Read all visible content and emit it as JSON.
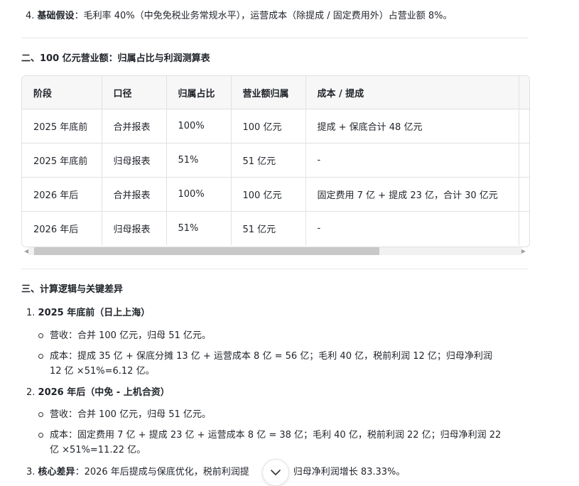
{
  "assumption": {
    "number": "4.",
    "label": "基础假设",
    "sep": "：",
    "text": "毛利率 40%（中免免税业务常规水平），运营成本（除提成 / 固定费用外）占营业额 8%。"
  },
  "section2": {
    "title": "二、100 亿元营业额：归属占比与利润测算表"
  },
  "table": {
    "headers": [
      "阶段",
      "口径",
      "归属占比",
      "营业额归属",
      "成本 / 提成"
    ],
    "rows": [
      [
        "2025 年底前",
        "合并报表",
        "100%",
        "100 亿元",
        "提成 + 保底合计 48 亿元"
      ],
      [
        "2025 年底前",
        "归母报表",
        "51%",
        "51 亿元",
        "-"
      ],
      [
        "2026 年后",
        "合并报表",
        "100%",
        "100 亿元",
        "固定费用 7 亿 + 提成 23 亿，合计 30 亿元"
      ],
      [
        "2026 年后",
        "归母报表",
        "51%",
        "51 亿元",
        "-"
      ]
    ]
  },
  "section3": {
    "title": "三、计算逻辑与关键差异",
    "items": [
      {
        "number": "1.",
        "title": "2025 年底前（日上上海）",
        "bullets": [
          "营收：合并 100 亿元，归母 51 亿元。",
          "成本：提成 35 亿 + 保底分摊 13 亿 + 运营成本 8 亿 = 56 亿；毛利 40 亿，税前利润 12 亿；归母净利润",
          "12 亿 ×51%=6.12 亿。"
        ]
      },
      {
        "number": "2.",
        "title": "2026 年后（中免 - 上机合资）",
        "bullets": [
          "营收：合并 100 亿元，归母 51 亿元。",
          "成本：固定费用 7 亿 + 提成 23 亿 + 运营成本 8 亿 = 38 亿；毛利 40 亿，税前利润 22 亿；归母净利润 22",
          "亿 ×51%=11.22 亿。"
        ]
      },
      {
        "number": "3.",
        "title": "核心差异",
        "sep": "：",
        "text_a": "2026 年后提成与保底优化，税前利润提",
        "text_b": "17%，归母净利润增长 83.33%。"
      }
    ]
  }
}
